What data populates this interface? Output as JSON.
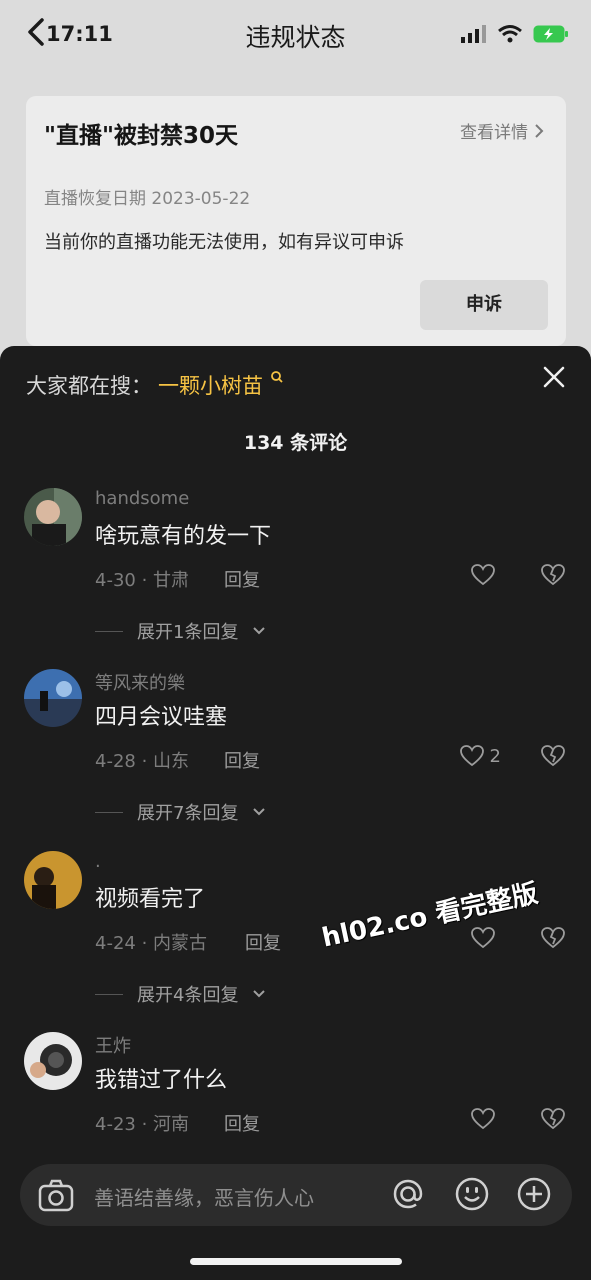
{
  "status_bar": {
    "time": "17:11"
  },
  "page": {
    "title": "违规状态"
  },
  "ban_card": {
    "title": "\"直播\"被封禁30天",
    "detail_link": "查看详情",
    "restore_date": "直播恢复日期 2023-05-22",
    "description": "当前你的直播功能无法使用，如有异议可申诉",
    "appeal_button": "申诉"
  },
  "comments_sheet": {
    "trending_label": "大家都在搜：",
    "trending_keyword": "一颗小树苗",
    "count_label": "134 条评论",
    "comments": [
      {
        "user": "handsome",
        "text": "啥玩意有的发一下",
        "meta": "4-30 · 甘肃",
        "reply": "回复",
        "likes": "",
        "expand": "展开1条回复"
      },
      {
        "user": "等风来的樂",
        "text": "四月会议哇塞",
        "meta": "4-28 · 山东",
        "reply": "回复",
        "likes": "2",
        "expand": "展开7条回复"
      },
      {
        "user": ".",
        "text": "视频看完了",
        "meta": "4-24 · 内蒙古",
        "reply": "回复",
        "likes": "",
        "expand": "展开4条回复"
      },
      {
        "user": "王炸",
        "text": "我错过了什么",
        "meta": "4-23 · 河南",
        "reply": "回复",
        "likes": "",
        "expand": ""
      }
    ]
  },
  "watermark": "hl02.co 看完整版",
  "input": {
    "placeholder": "善语结善缘，恶言伤人心"
  },
  "colors": {
    "accent_keyword": "#f6c344",
    "sheet_bg": "#1c1c1c"
  }
}
